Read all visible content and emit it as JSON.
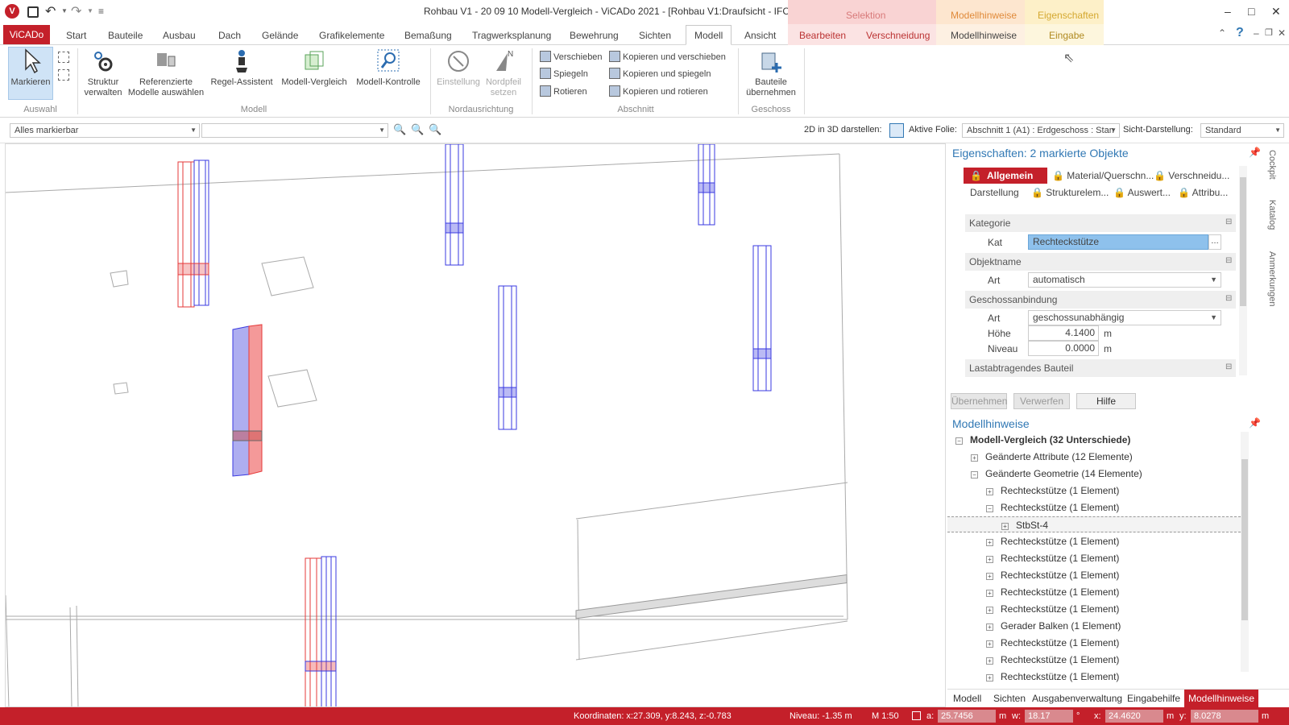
{
  "window": {
    "title": "Rohbau V1 - 20 09 10 Modell-Vergleich - ViCADo 2021 - [Rohbau V1:Draufsicht - IFC]",
    "context_group_selektion": "Selektion",
    "context_group_modellhinweise": "Modellhinweise",
    "context_group_eigenschaften": "Eigenschaften",
    "controls": {
      "minimize": "–",
      "maximize": "□",
      "close": "✕",
      "help": "?"
    }
  },
  "app_button": "ViCADo",
  "tabs": [
    "Start",
    "Bauteile",
    "Ausbau",
    "Dach",
    "Gelände",
    "Grafikelemente",
    "Bemaßung",
    "Tragwerksplanung",
    "Bewehrung",
    "Sichten",
    "Modell",
    "Ansicht"
  ],
  "context_tabs": [
    "Bearbeiten",
    "Verschneidung",
    "Modellhinweise",
    "Eingabe"
  ],
  "ribbon": {
    "markieren": "Markieren",
    "auswahl_group": "Auswahl",
    "struktur": "Struktur verwalten",
    "referenzierte": "Referenzierte Modelle auswählen",
    "regel": "Regel-Assistent",
    "vergleich": "Modell-Vergleich",
    "kontrolle": "Modell-Kontrolle",
    "modell_group": "Modell",
    "einstellung": "Einstellung",
    "nordpfeil": "Nordpfeil setzen",
    "nord_group": "Nordausrichtung",
    "verschieben": "Verschieben",
    "spiegeln": "Spiegeln",
    "rotieren": "Rotieren",
    "kopieren_verschieben": "Kopieren und verschieben",
    "kopieren_spiegeln": "Kopieren und spiegeln",
    "kopieren_rotieren": "Kopieren und rotieren",
    "abschnitt_group": "Abschnitt",
    "bauteile_uebernehmen": "Bauteile übernehmen",
    "geschoss_group": "Geschoss"
  },
  "toolbar": {
    "filter_combo": "Alles markierbar",
    "second_combo": "",
    "label_2d3d": "2D in 3D darstellen:",
    "label_folie": "Aktive Folie:",
    "folie_value": "Abschnitt 1 (A1) : Erdgeschoss : Stan",
    "label_sicht": "Sicht-Darstellung:",
    "sicht_value": "Standard"
  },
  "properties": {
    "title": "Eigenschaften: 2 markierte Objekte",
    "tabs": [
      "Allgemein",
      "Material/Querschn...",
      "Verschneidu...",
      "Darstellung",
      "Strukturelem...",
      "Auswert...",
      "Attribu..."
    ],
    "sections": {
      "kategorie": "Kategorie",
      "objektname": "Objektname",
      "geschoss": "Geschossanbindung",
      "lastabtragend": "Lastabtragendes Bauteil"
    },
    "labels": {
      "kat": "Kat",
      "art1": "Art",
      "art2": "Art",
      "hoehe": "Höhe",
      "niveau": "Niveau"
    },
    "values": {
      "kat": "Rechteckstütze",
      "art1": "automatisch",
      "art2": "geschossunabhängig",
      "hoehe": "4.1400",
      "niveau": "0.0000",
      "unit": "m"
    },
    "buttons": {
      "uebernehmen": "Übernehmen",
      "verwerfen": "Verwerfen",
      "hilfe": "Hilfe"
    }
  },
  "modellhinweise": {
    "title": "Modellhinweise",
    "tree": [
      {
        "label": "Modell-Vergleich (32 Unterschiede)",
        "level": 0,
        "expanded": true,
        "bold": true
      },
      {
        "label": "Geänderte Attribute (12 Elemente)",
        "level": 1,
        "expanded": false
      },
      {
        "label": "Geänderte Geometrie (14 Elemente)",
        "level": 1,
        "expanded": true
      },
      {
        "label": "Rechteckstütze (1 Element)",
        "level": 2,
        "expanded": false
      },
      {
        "label": "Rechteckstütze (1 Element)",
        "level": 2,
        "expanded": true
      },
      {
        "label": "StbSt-4",
        "level": 3,
        "expanded": false,
        "selected": true
      },
      {
        "label": "Rechteckstütze (1 Element)",
        "level": 2,
        "expanded": false
      },
      {
        "label": "Rechteckstütze (1 Element)",
        "level": 2,
        "expanded": false
      },
      {
        "label": "Rechteckstütze (1 Element)",
        "level": 2,
        "expanded": false
      },
      {
        "label": "Rechteckstütze (1 Element)",
        "level": 2,
        "expanded": false
      },
      {
        "label": "Rechteckstütze (1 Element)",
        "level": 2,
        "expanded": false
      },
      {
        "label": "Gerader Balken (1 Element)",
        "level": 2,
        "expanded": false
      },
      {
        "label": "Rechteckstütze (1 Element)",
        "level": 2,
        "expanded": false
      },
      {
        "label": "Rechteckstütze (1 Element)",
        "level": 2,
        "expanded": false
      },
      {
        "label": "Rechteckstütze (1 Element)",
        "level": 2,
        "expanded": false
      }
    ]
  },
  "bottom_tabs": [
    "Modell",
    "Sichten",
    "Ausgabenverwaltung",
    "Eingabehilfe",
    "Modellhinweise"
  ],
  "side_tabs": [
    "Cockpit",
    "Katalog",
    "Anmerkungen"
  ],
  "status": {
    "koordinaten": "Koordinaten: x:27.309, y:8.243, z:-0.783",
    "niveau": "Niveau: -1.35 m",
    "massstab": "M 1:50",
    "a_label": "a:",
    "a_value": "25.7456",
    "w_label": "w:",
    "w_value": "18.17",
    "x_label": "x:",
    "x_value": "24.4620",
    "y_label": "y:",
    "y_value": "8.0278",
    "unit_m": "m",
    "unit_deg": "°"
  },
  "colors": {
    "brand_red": "#c4202a",
    "title_blue": "#3178b4",
    "context_selektion": "#f9d3d3",
    "context_modellhinweise": "#fde6cf",
    "context_eigenschaften": "#fdf0c8",
    "column_red": "#e63a3a",
    "column_blue": "#3a3ae0"
  }
}
